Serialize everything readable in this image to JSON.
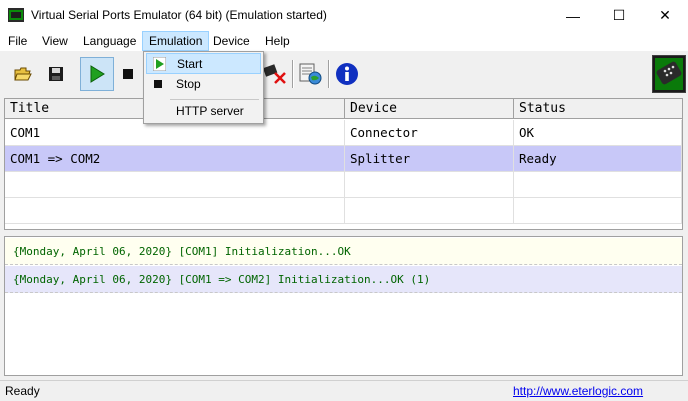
{
  "window": {
    "title": "Virtual Serial Ports Emulator (64 bit) (Emulation started)",
    "minimize": "—",
    "maximize": "☐",
    "close": "✕"
  },
  "menu": {
    "items": [
      "File",
      "View",
      "Language",
      "Emulation",
      "Device",
      "Help"
    ]
  },
  "dropdown": {
    "start": "Start",
    "stop": "Stop",
    "http": "HTTP server"
  },
  "table": {
    "headers": [
      "Title",
      "Device",
      "Status"
    ],
    "rows": [
      [
        "COM1",
        "Connector",
        "OK"
      ],
      [
        "COM1 => COM2",
        "Splitter",
        "Ready"
      ]
    ]
  },
  "log": [
    "{Monday, April 06, 2020} [COM1] Initialization...OK",
    "{Monday, April 06, 2020} [COM1 => COM2] Initialization...OK (1)"
  ],
  "status": {
    "text": "Ready",
    "link": "http://www.eterlogic.com"
  },
  "colors": {
    "selected_row": "#c8c8f8",
    "log_text": "#006400",
    "menu_highlight": "#cce8ff",
    "link": "#0000ee"
  },
  "icons": [
    "open-folder-icon",
    "save-disk-icon",
    "play-icon",
    "stop-square-icon",
    "delete-device-icon",
    "device-globe-icon",
    "info-icon",
    "serial-port-icon"
  ]
}
